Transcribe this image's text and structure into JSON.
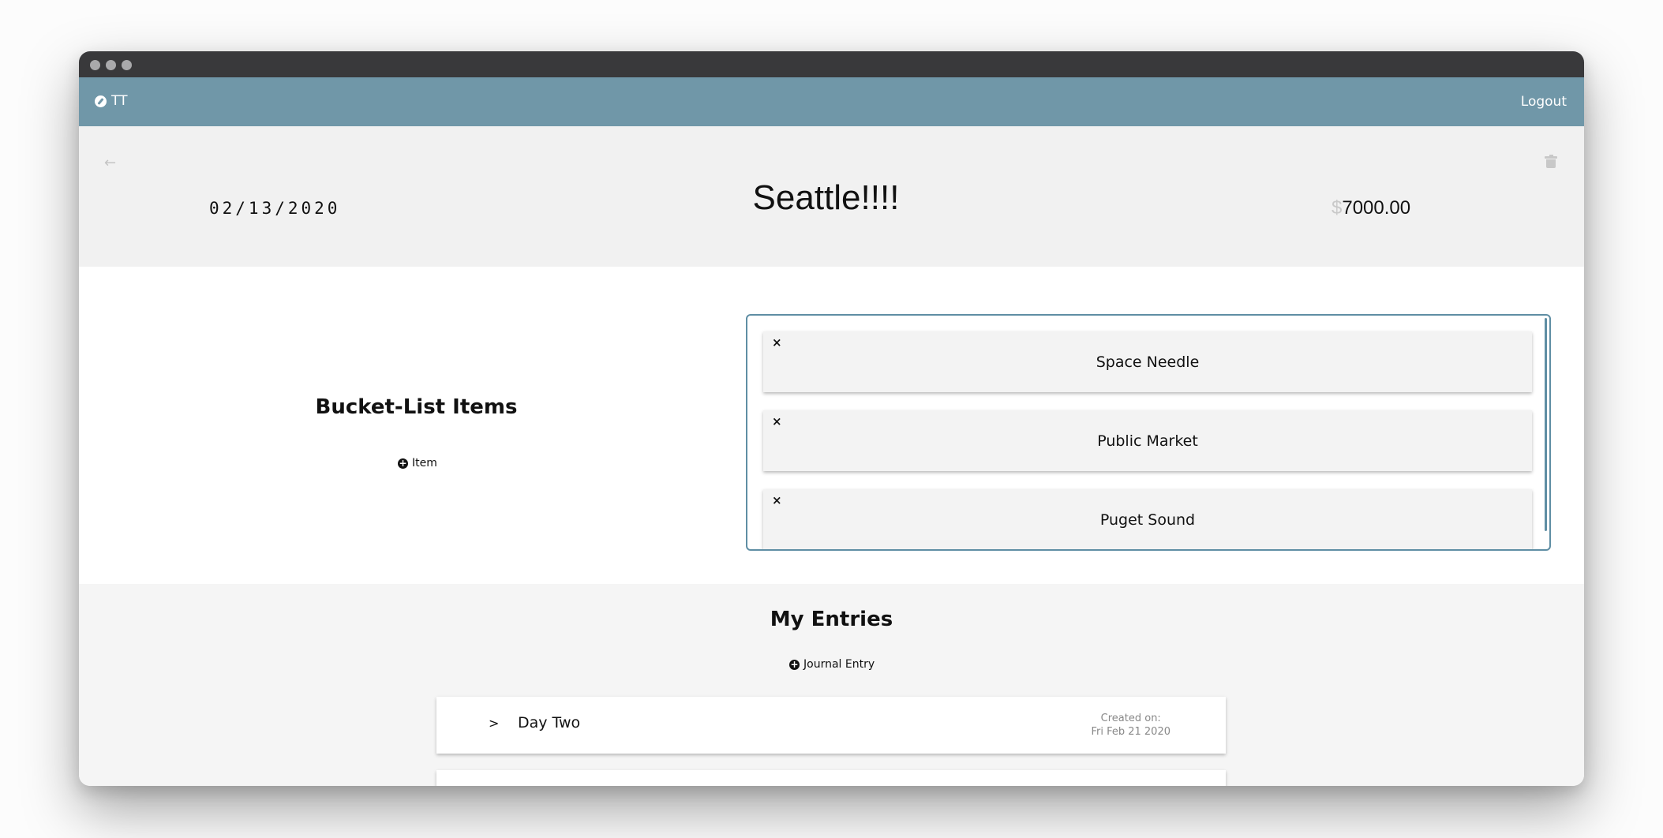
{
  "window": {
    "traffic_lights": [
      "close",
      "minimize",
      "maximize"
    ]
  },
  "navbar": {
    "brand": "TT",
    "brand_icon": "compass-icon",
    "logout_label": "Logout"
  },
  "trip": {
    "date": "02/13/2020",
    "title": "Seattle!!!!",
    "budget_currency": "$",
    "budget_value": "7000.00"
  },
  "bucket_list": {
    "heading": "Bucket-List Items",
    "add_label": "Item",
    "remove_symbol": "×",
    "items": [
      {
        "label": "Space Needle"
      },
      {
        "label": "Public Market"
      },
      {
        "label": "Puget Sound"
      }
    ]
  },
  "entries": {
    "heading": "My Entries",
    "add_label": "Journal Entry",
    "items": [
      {
        "expand_symbol": ">",
        "title": "Day Two",
        "created_label": "Created on:",
        "created_date": "Fri Feb 21 2020"
      },
      {
        "expand_symbol": "",
        "title": "",
        "created_label": "",
        "created_date": ""
      }
    ]
  },
  "colors": {
    "navbar": "#7097a8",
    "titlebar": "#39393b",
    "accent_border": "#5f8ea4",
    "header_bg": "#f1f1f1"
  }
}
